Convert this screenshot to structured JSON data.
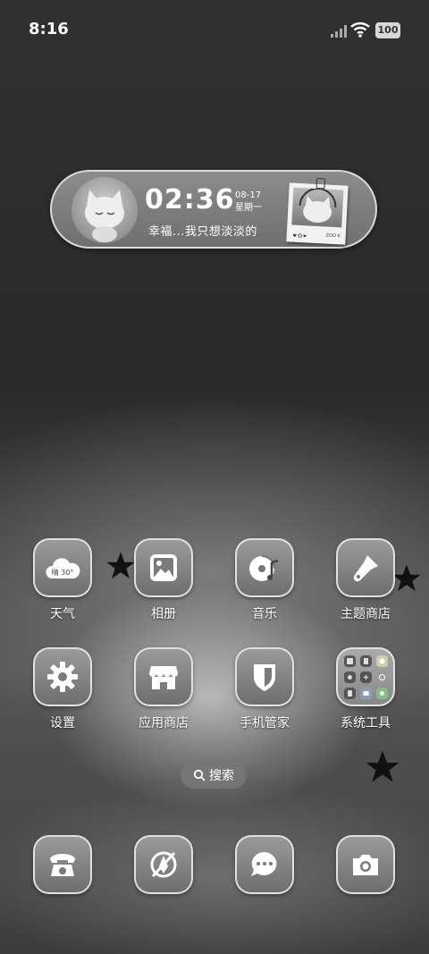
{
  "status_bar": {
    "time": "8:16",
    "battery": "100"
  },
  "widget": {
    "clock": "02:36",
    "date": "08-17",
    "weekday": "星期一",
    "caption": "幸福...我只想淡淡的",
    "polaroid_signature": "ZOO K"
  },
  "apps": [
    {
      "label": "天气",
      "icon": "weather-icon",
      "icon_text": "晴 30°"
    },
    {
      "label": "相册",
      "icon": "gallery-icon"
    },
    {
      "label": "音乐",
      "icon": "music-icon"
    },
    {
      "label": "主题商店",
      "icon": "paint-brush-icon"
    },
    {
      "label": "设置",
      "icon": "gear-icon"
    },
    {
      "label": "应用商店",
      "icon": "store-icon"
    },
    {
      "label": "手机管家",
      "icon": "shield-icon"
    },
    {
      "label": "系统工具",
      "icon": "folder-icon"
    }
  ],
  "search": {
    "label": "搜索"
  },
  "dock": [
    {
      "icon": "phone-icon"
    },
    {
      "icon": "browser-icon"
    },
    {
      "icon": "messages-icon"
    },
    {
      "icon": "camera-icon"
    }
  ],
  "colors": {
    "icon_bg": "#8a8a8a",
    "icon_border": "#ebebeb",
    "text": "#ffffff"
  }
}
